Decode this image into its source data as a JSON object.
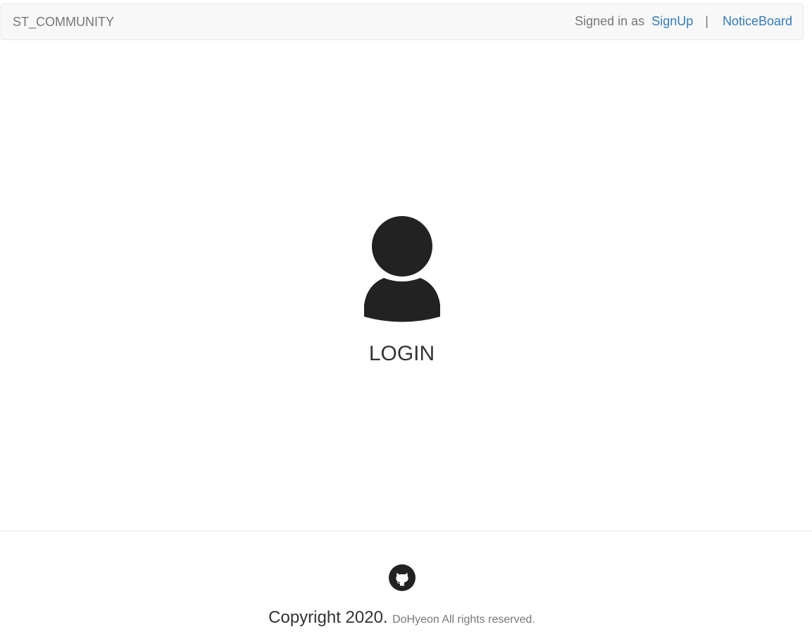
{
  "navbar": {
    "brand": "ST_COMMUNITY",
    "signed_in_text": "Signed in as",
    "signup_link": "SignUp",
    "separator": "|",
    "noticeboard_link": "NoticeBoard"
  },
  "main": {
    "login_icon": "user-icon",
    "login_label": "LOGIN"
  },
  "footer": {
    "github_icon": "github-icon",
    "copyright_main": "Copyright 2020.",
    "copyright_small": "DoHyeon All rights reserved."
  },
  "colors": {
    "link": "#337ab7",
    "navbar_bg": "#f8f8f8",
    "navbar_border": "#e7e7e7",
    "muted_text": "#777777",
    "main_text": "#333333",
    "icon": "#222222"
  }
}
